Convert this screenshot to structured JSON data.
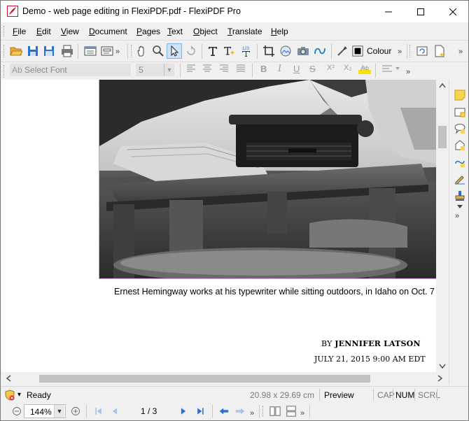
{
  "window": {
    "title": "Demo - web page editing in FlexiPDF.pdf - FlexiPDF Pro",
    "controls": {
      "minimize": "minimize-icon",
      "maximize": "maximize-icon",
      "close": "close-icon"
    }
  },
  "menu": {
    "items": [
      {
        "label": "File",
        "mnemonic": "F",
        "rest": "ile"
      },
      {
        "label": "Edit",
        "mnemonic": "E",
        "rest": "dit"
      },
      {
        "label": "View",
        "mnemonic": "V",
        "rest": "iew"
      },
      {
        "label": "Document",
        "mnemonic": "D",
        "rest": "ocument"
      },
      {
        "label": "Pages",
        "mnemonic": "P",
        "rest": "ages"
      },
      {
        "label": "Text",
        "mnemonic": "T",
        "rest": "ext"
      },
      {
        "label": "Object",
        "mnemonic": "O",
        "rest": "bject"
      },
      {
        "label": "Translate",
        "mnemonic": "T",
        "rest": "ranslate"
      },
      {
        "label": "Help",
        "mnemonic": "H",
        "rest": "elp"
      }
    ]
  },
  "toolbar": {
    "colour_label": "Colour",
    "font_placeholder": "Select Font",
    "font_size": "5",
    "superscript": "X²",
    "subscript": "X₂"
  },
  "document": {
    "caption": "Ernest Hemingway works at his typewriter while sitting outdoors, in Idaho on Oct. 7",
    "byline_prefix": "BY",
    "byline_name": "JENNIFER LATSON",
    "dateline": "JULY 21, 2015 9:00 AM EDT"
  },
  "status": {
    "state": "Ready",
    "page_size": "20.98 x 29.69 cm",
    "mode": "Preview",
    "cap": "CAP",
    "num": "NUM",
    "scrl": "SCRL"
  },
  "navigation": {
    "zoom": "144%",
    "page_indicator": "1 / 3"
  },
  "colors": {
    "accent_blue": "#2a6fd6",
    "pdf_red": "#c8102e",
    "image_border": "#d59ad5"
  }
}
